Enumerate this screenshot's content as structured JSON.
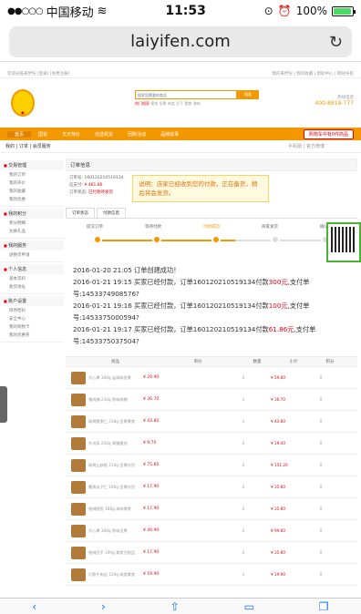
{
  "status": {
    "carrier": "中国移动",
    "time": "11:53",
    "battery": "100%"
  },
  "browser": {
    "url": "laiyifen.com"
  },
  "site": {
    "topline_left": "欢迎光临来伊份 [登录] [免费注册]",
    "topline_right": "我的来伊份 | 我的收藏 | 帮助中心 | 网站导航",
    "search_placeholder": "搜索您需要的商品",
    "search_button": "搜索",
    "hot_label": "热门搜索",
    "hot_words": "蜜饯 坚果 肉类 豆干 素食 海味",
    "hotline_label": "热线电话",
    "hotline_phone": "400-8819-777",
    "nav": [
      "首页",
      "国货",
      "天天特价",
      "自选组货",
      "团购活动",
      "品牌故事"
    ],
    "cart_label": "购物车中有0件商品",
    "crumb_left": "我的 | 订单 | 会员服务",
    "crumb_right": "手机版 | 官方微博"
  },
  "sidebar": [
    {
      "title": "交易管理",
      "items": [
        "我的订单",
        "我的评价",
        "我的收藏",
        "我的优惠"
      ]
    },
    {
      "title": "我的积分",
      "items": [
        "积分明细",
        "兑换礼品"
      ]
    },
    {
      "title": "我的服务",
      "items": [
        "退换货申请"
      ]
    },
    {
      "title": "个人信息",
      "items": [
        "基本资料",
        "收货地址"
      ]
    },
    {
      "title": "账户设置",
      "items": [
        "修改密码",
        "安全中心",
        "我的购物卡",
        "我的优惠券"
      ]
    }
  ],
  "order": {
    "title": "订单信息",
    "no_label": "订单号:",
    "no_value": "160120210519134",
    "amount_label": "应支付:",
    "amount_value": "¥ 461.86",
    "status_label": "订单状态:",
    "status_value": "已付款待发货",
    "notice": "说明：店家已经收到您的付款，正在备货，稍后将会发货。",
    "tabs": [
      "订单状态",
      "付款信息"
    ],
    "steps": [
      "提交订单",
      "等待付款",
      "付款成功",
      "商家发货",
      "确认收货"
    ],
    "log": [
      {
        "pre": "2016-01-20 21:05  订单创建成功！",
        "amt": "",
        "post": ""
      },
      {
        "pre": "2016-01-21 19:15  买家已经付款，订单160120210519134付款",
        "amt": "300元",
        "post": ",支付单号:1453374908576?"
      },
      {
        "pre": "2016-01-21 19:16  买家已经付款，订单160120210519134付款",
        "amt": "100元",
        "post": ",支付单号:1453375000594?"
      },
      {
        "pre": "2016-01-21 19:17  买家已经付款，订单160120210519134付款",
        "amt": "61.86元",
        "post": ",支付单号:1453375037504?"
      }
    ]
  },
  "table": {
    "headers": [
      "商品",
      "单价",
      "数量",
      "小计",
      "积分"
    ],
    "rows": [
      {
        "name": "开心果 160g 盐焗味坚果",
        "price": "¥ 29.90",
        "qty": "2",
        "sub": "¥ 59.80",
        "pt": "0"
      },
      {
        "name": "猪肉脯 230g 原味肉脯",
        "price": "¥ 36.70",
        "qty": "1",
        "sub": "¥ 36.70",
        "pt": "0"
      },
      {
        "name": "碳烤腰果仁 238g 坚果零食",
        "price": "¥ 43.80",
        "qty": "1",
        "sub": "¥ 43.80",
        "pt": "0"
      },
      {
        "name": "冬瓜条 250g 果脯蜜饯",
        "price": "¥ 9.70",
        "qty": "2",
        "sub": "¥ 19.40",
        "pt": "0"
      },
      {
        "name": "碳烤山核桃 210g 坚果炒货",
        "price": "¥ 75.60",
        "qty": "2",
        "sub": "¥ 151.20",
        "pt": "0"
      },
      {
        "name": "蟹黄瓜子仁 160g 坚果炒货",
        "price": "¥ 17.90",
        "qty": "2",
        "sub": "¥ 35.80",
        "pt": "0"
      },
      {
        "name": "香辣鱿鱼 168g 海味零食",
        "price": "¥ 17.90",
        "qty": "2",
        "sub": "¥ 35.80",
        "pt": "0"
      },
      {
        "name": "开心果 160g 原味坚果",
        "price": "¥ 49.90",
        "qty": "2",
        "sub": "¥ 99.80",
        "pt": "0"
      },
      {
        "name": "香辣豆干 190g 素食豆制品",
        "price": "¥ 17.90",
        "qty": "2",
        "sub": "¥ 35.80",
        "pt": "0"
      },
      {
        "name": "灯影牛肉丝 120g 肉类零食",
        "price": "¥ 19.90",
        "qty": "1",
        "sub": "¥ 19.90",
        "pt": "0"
      }
    ]
  },
  "colors": {
    "brand": "#f39800",
    "price": "#e60012"
  }
}
